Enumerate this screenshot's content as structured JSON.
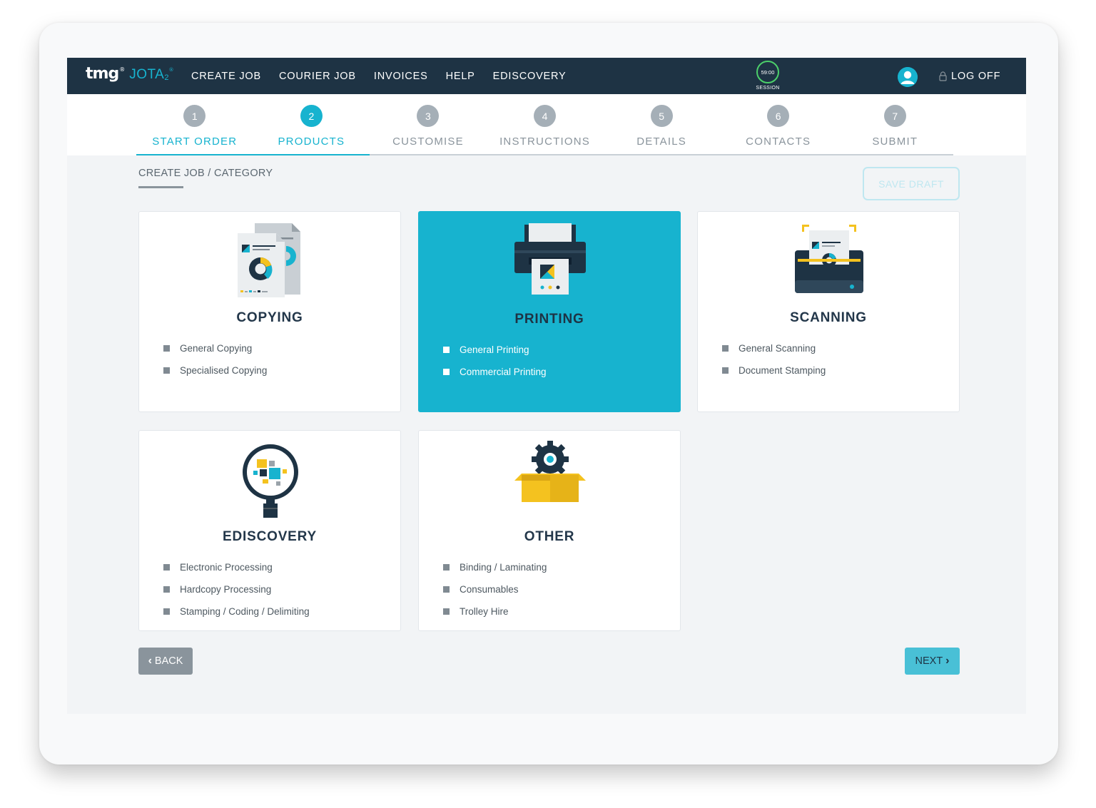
{
  "nav": {
    "logo_brand": "tmg",
    "logo_product": "JOTA",
    "logo_version": "2",
    "links": [
      "CREATE JOB",
      "COURIER JOB",
      "INVOICES",
      "HELP",
      "EDISCOVERY"
    ],
    "session_time": "59:00",
    "session_label": "SESSION",
    "logoff_label": "LOG OFF"
  },
  "steps": [
    {
      "num": "1",
      "label": "START ORDER",
      "state": "done"
    },
    {
      "num": "2",
      "label": "PRODUCTS",
      "state": "active"
    },
    {
      "num": "3",
      "label": "CUSTOMISE",
      "state": "pending"
    },
    {
      "num": "4",
      "label": "INSTRUCTIONS",
      "state": "pending"
    },
    {
      "num": "5",
      "label": "DETAILS",
      "state": "pending"
    },
    {
      "num": "6",
      "label": "CONTACTS",
      "state": "pending"
    },
    {
      "num": "7",
      "label": "SUBMIT",
      "state": "pending"
    }
  ],
  "breadcrumb": "CREATE JOB / CATEGORY",
  "save_draft_label": "SAVE DRAFT",
  "cards": [
    {
      "title": "COPYING",
      "icon": "copy-documents-icon",
      "items": [
        "General Copying",
        "Specialised Copying"
      ],
      "selected": false
    },
    {
      "title": "PRINTING",
      "icon": "printer-icon",
      "items": [
        "General Printing",
        "Commercial Printing"
      ],
      "selected": true
    },
    {
      "title": "SCANNING",
      "icon": "scanner-icon",
      "items": [
        "General Scanning",
        "Document Stamping"
      ],
      "selected": false
    },
    {
      "title": "EDISCOVERY",
      "icon": "magnifier-data-icon",
      "items": [
        "Electronic Processing",
        "Hardcopy Processing",
        "Stamping / Coding / Delimiting"
      ],
      "selected": false
    },
    {
      "title": "OTHER",
      "icon": "gear-box-icon",
      "items": [
        "Binding / Laminating",
        "Consumables",
        "Trolley Hire"
      ],
      "selected": false
    }
  ],
  "back_label": "BACK",
  "next_label": "NEXT",
  "colors": {
    "accent": "#17b3cf",
    "navy": "#1e3344",
    "session_ring": "#4cd06a",
    "yellow": "#f4c21f"
  }
}
